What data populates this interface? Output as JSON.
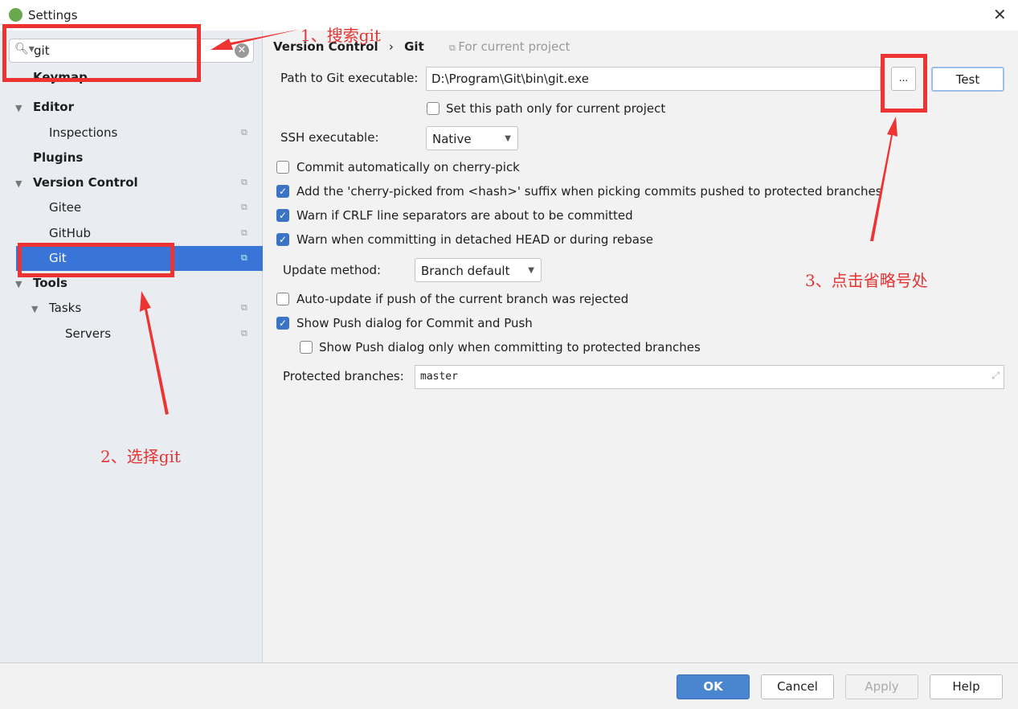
{
  "window": {
    "title": "Settings",
    "close": "✕"
  },
  "search": {
    "value": "git",
    "icon": "search-icon",
    "clear": "✕"
  },
  "sidebar": {
    "items": [
      {
        "label": "Keymap"
      },
      {
        "label": "Editor"
      },
      {
        "label": "Inspections"
      },
      {
        "label": "Plugins"
      },
      {
        "label": "Version Control"
      },
      {
        "label": "Gitee"
      },
      {
        "label": "GitHub"
      },
      {
        "label": "Git",
        "selected": true
      },
      {
        "label": "Tools"
      },
      {
        "label": "Tasks"
      },
      {
        "label": "Servers"
      }
    ]
  },
  "breadcrumb": {
    "parent": "Version Control",
    "sep": "›",
    "current": "Git",
    "scope": "For current project"
  },
  "git": {
    "path_label": "Path to Git executable:",
    "path_value": "D:\\Program\\Git\\bin\\git.exe",
    "browse": "...",
    "test": "Test",
    "path_only_project": "Set this path only for current project",
    "ssh_label": "SSH executable:",
    "ssh_value": "Native",
    "opt_cherry": "Commit automatically on cherry-pick",
    "opt_suffix": "Add the 'cherry-picked from <hash>' suffix when picking commits pushed to protected branches",
    "opt_crlf": "Warn if CRLF line separators are about to be committed",
    "opt_detached": "Warn when committing in detached HEAD or during rebase",
    "update_label": "Update method:",
    "update_value": "Branch default",
    "opt_autoupdate": "Auto-update if push of the current branch was rejected",
    "opt_pushdialog": "Show Push dialog for Commit and Push",
    "opt_pushprotected": "Show Push dialog only when committing to protected branches",
    "protected_label": "Protected branches:",
    "protected_value": "master"
  },
  "footer": {
    "ok": "OK",
    "cancel": "Cancel",
    "apply": "Apply",
    "help": "Help"
  },
  "annotations": {
    "step1": "1、搜索git",
    "step2": "2、选择git",
    "step3": "3、点击省略号处",
    "color": "#ee3333"
  }
}
